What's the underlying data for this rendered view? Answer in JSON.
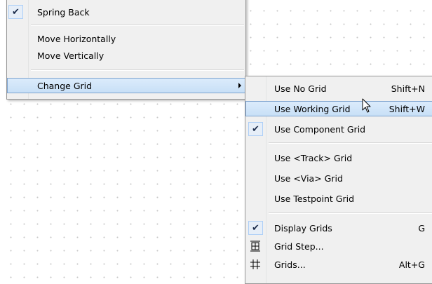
{
  "main_menu": {
    "items": [
      {
        "label": "Spring Back",
        "checked": true
      },
      {
        "label": "Move Horizontally"
      },
      {
        "label": "Move Vertically"
      },
      {
        "label": "Change Grid",
        "has_submenu": true,
        "highlighted": true
      }
    ]
  },
  "submenu": {
    "items": [
      {
        "label": "Use No Grid",
        "shortcut": "Shift+N"
      },
      {
        "label": "Use Working Grid",
        "shortcut": "Shift+W",
        "highlighted": true
      },
      {
        "label": "Use Component Grid",
        "checked": true
      },
      {
        "label": "Use <Track> Grid"
      },
      {
        "label": "Use <Via> Grid"
      },
      {
        "label": "Use Testpoint Grid"
      },
      {
        "label": "Display Grids",
        "shortcut": "G",
        "checked": true
      },
      {
        "label": "Grid Step...",
        "icon": "grid-step-icon"
      },
      {
        "label": "Grids...",
        "shortcut": "Alt+G",
        "icon": "grid-icon"
      }
    ]
  },
  "colors": {
    "menu_background": "#f0f0f0",
    "highlight_border": "#7da2ce",
    "highlight_fill": "#c7dff6",
    "grid_dots": "#c8c8c8"
  }
}
